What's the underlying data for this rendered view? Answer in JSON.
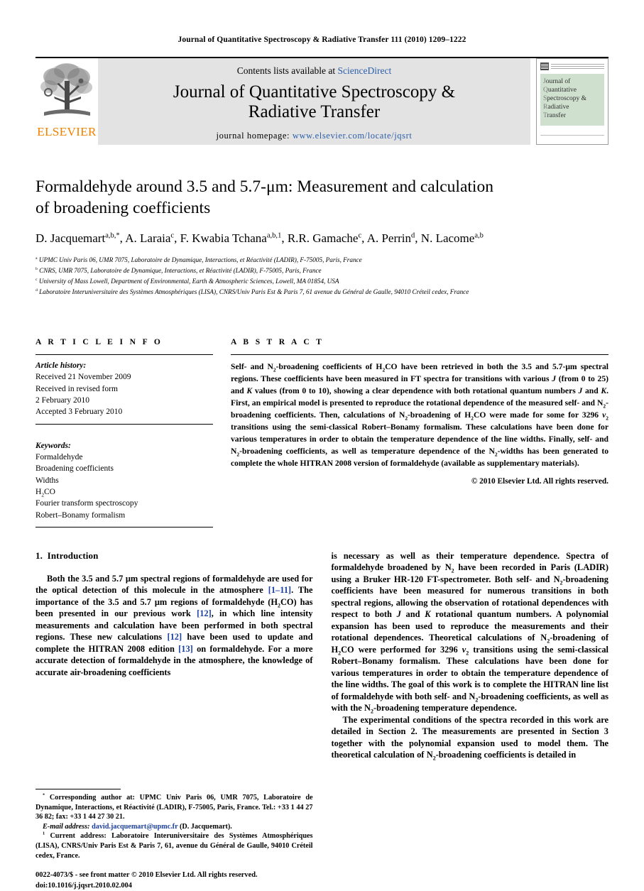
{
  "running_head": "Journal of Quantitative Spectroscopy & Radiative Transfer 111 (2010) 1209–1222",
  "masthead": {
    "publisher_name": "ELSEVIER",
    "contents_prefix": "Contents lists available at ",
    "contents_link": "ScienceDirect",
    "journal_title_line1": "Journal of Quantitative Spectroscopy &",
    "journal_title_line2": "Radiative Transfer",
    "homepage_prefix": "journal homepage: ",
    "homepage_url": "www.elsevier.com/locate/jqsrt",
    "cover_lines": [
      {
        "cap": "J",
        "rest": "ournal of"
      },
      {
        "cap": "Q",
        "rest": "uantitative"
      },
      {
        "cap": "S",
        "rest": "pectroscopy &"
      },
      {
        "cap": "R",
        "rest": "adiative"
      },
      {
        "cap": "T",
        "rest": "ransfer"
      }
    ]
  },
  "article": {
    "title_line1": "Formaldehyde around 3.5 and 5.7-μm: Measurement and calculation",
    "title_line2": "of broadening coefficients",
    "authors": [
      {
        "name": "D. Jacquemart",
        "marks": "a,b,*"
      },
      {
        "name": "A. Laraia",
        "marks": "c"
      },
      {
        "name": "F. Kwabia Tchana",
        "marks": "a,b,1"
      },
      {
        "name": "R.R. Gamache",
        "marks": "c"
      },
      {
        "name": "A. Perrin",
        "marks": "d"
      },
      {
        "name": "N. Lacome",
        "marks": "a,b"
      }
    ],
    "affiliations": [
      {
        "mark": "a",
        "text": "UPMC Univ Paris 06, UMR 7075, Laboratoire de Dynamique, Interactions, et Réactivité (LADIR), F-75005, Paris, France"
      },
      {
        "mark": "b",
        "text": "CNRS, UMR 7075, Laboratoire de Dynamique, Interactions, et Réactivité (LADIR), F-75005, Paris, France"
      },
      {
        "mark": "c",
        "text": "University of Mass Lowell, Department of Environmental, Earth & Atmospheric Sciences, Lowell, MA 01854, USA"
      },
      {
        "mark": "d",
        "text": "Laboratoire Interuniversitaire des Systèmes Atmosphériques (LISA), CNRS/Univ Paris Est & Paris 7, 61 avenue du Général de Gaulle, 94010 Créteil cedex, France"
      }
    ]
  },
  "article_info": {
    "heading": "A R T I C L E   I N F O",
    "history_label": "Article history:",
    "history_lines": [
      "Received 21 November 2009",
      "Received in revised form",
      "2 February 2010",
      "Accepted 3 February 2010"
    ],
    "keywords_label": "Keywords:",
    "keywords": [
      "Formaldehyde",
      "Broadening coefficients",
      "Widths",
      "H2CO",
      "Fourier transform spectroscopy",
      "Robert–Bonamy formalism"
    ]
  },
  "abstract": {
    "heading": "A B S T R A C T",
    "copyright": "© 2010 Elsevier Ltd. All rights reserved."
  },
  "introduction": {
    "number": "1.",
    "title": "Introduction"
  },
  "footnotes": {
    "corresponding_mark": "*",
    "corresponding_text": "Corresponding author at: UPMC Univ Paris 06, UMR 7075, Laboratoire de Dynamique, Interactions, et Réactivité (LADIR), F-75005, Paris, France. Tel.: +33 1 44 27 36 82; fax: +33 1 44 27 30 21.",
    "email_label": "E-mail address:",
    "email": "david.jacquemart@upmc.fr",
    "email_suffix": "(D. Jacquemart).",
    "current_address_mark": "1",
    "current_address_text": "Current address: Laboratoire Interuniversitaire des Systèmes Atmosphériques (LISA), CNRS/Univ Paris Est & Paris 7, 61, avenue du Général de Gaulle, 94010 Créteil cedex, France.",
    "issn_line": "0022-4073/$ - see front matter © 2010 Elsevier Ltd. All rights reserved.",
    "doi_line": "doi:10.1016/j.jqsrt.2010.02.004"
  },
  "colors": {
    "link": "#2b5eaa",
    "citation": "#1a3fa0",
    "elsevier_orange": "#ef8200",
    "banner_gray": "#e3e3e3",
    "cover_green": "#cfe0cf"
  }
}
